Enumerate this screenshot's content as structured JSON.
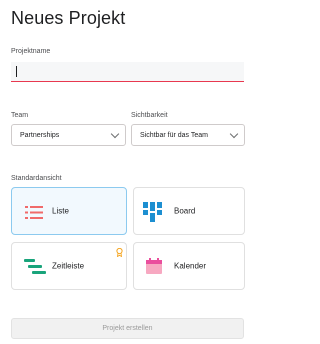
{
  "dialog": {
    "title": "Neues Projekt"
  },
  "project_name": {
    "label": "Projektname",
    "value": ""
  },
  "team": {
    "label": "Team",
    "selected": "Partnerships"
  },
  "visibility": {
    "label": "Sichtbarkeit",
    "selected": "Sichtbar für das Team"
  },
  "default_view": {
    "label": "Standardansicht",
    "options": [
      {
        "label": "Liste",
        "icon": "list-icon",
        "selected": true
      },
      {
        "label": "Board",
        "icon": "board-icon",
        "selected": false
      },
      {
        "label": "Zeitleiste",
        "icon": "timeline-icon",
        "selected": false,
        "badge_icon": "premium-icon"
      },
      {
        "label": "Kalender",
        "icon": "calendar-icon",
        "selected": false
      }
    ]
  },
  "submit": {
    "label": "Projekt erstellen",
    "enabled": false
  },
  "colors": {
    "error_underline": "#e8384f",
    "list_icon": "#f06a6a",
    "board_icon": "#1d8fd1",
    "timeline_icon": "#19a47b",
    "calendar_icon": "#f7a8c1",
    "premium_icon": "#f5a623",
    "selected_border": "#8ccaef"
  }
}
